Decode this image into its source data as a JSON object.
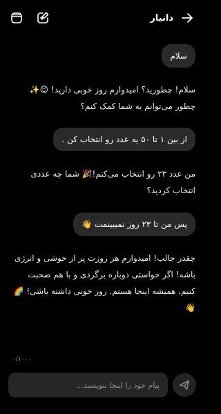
{
  "header": {
    "title": "دانیار",
    "icons": [
      "archive-icon",
      "new-chat-icon",
      "arrow-right-icon"
    ]
  },
  "messages": [
    {
      "role": "user",
      "text": "سلام"
    },
    {
      "role": "bot",
      "text": "سلام! چطورید؟ امیدوارم روز خوبی دارید! 😊✨ چطور می‌توانم به شما کمک کنم؟"
    },
    {
      "role": "user",
      "text": "از بین ۱ تا ۵۰ یه عدد رو انتخاب کن ."
    },
    {
      "role": "bot",
      "text": "من عدد ۲۳ رو انتخاب می‌کنم!🎉 شما چه عددی انتخاب کردید؟"
    },
    {
      "role": "user",
      "text": "پس من تا ۲۳ روز نمیبینمت 👋"
    },
    {
      "role": "bot",
      "text": "چقدر جالب! امیدوارم هر روزت پر از خوشی و انرژی باشه! اگر خواستی دوباره برگردی و با هم صحبت کنیم، همیشه اینجا هستم. روز خوبی داشته باشی! 🌈👋"
    }
  ],
  "composer": {
    "counter": "۰/۱۰۰۰",
    "placeholder": "پیام خود را اینجا بنویسید..."
  }
}
